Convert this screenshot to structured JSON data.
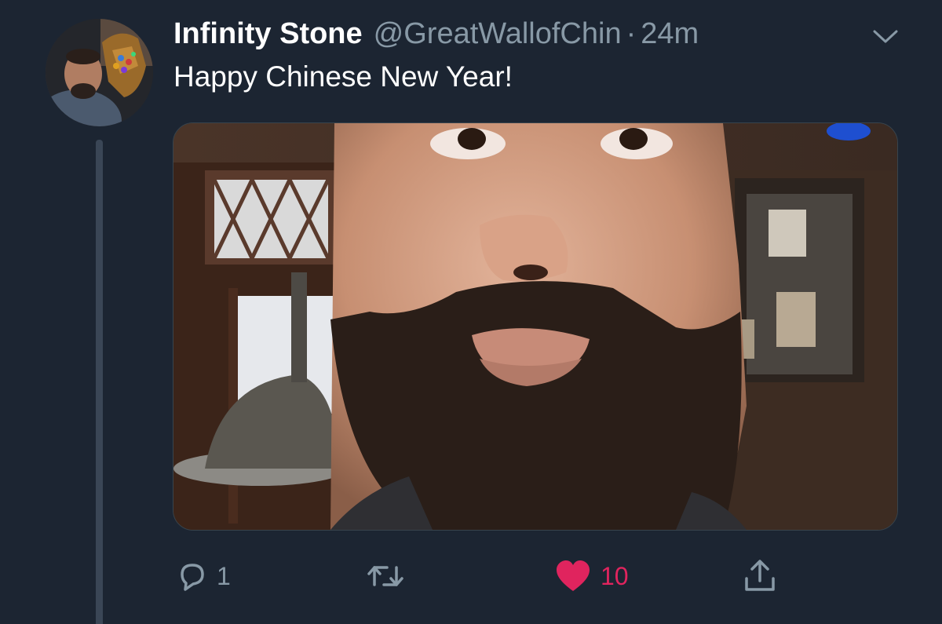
{
  "tweet": {
    "display_name": "Infinity Stone",
    "handle": "@GreatWallofChin",
    "separator": "·",
    "timestamp": "24m",
    "text": "Happy Chinese New Year!"
  },
  "actions": {
    "reply": {
      "icon": "reply-icon",
      "count": "1"
    },
    "retweet": {
      "icon": "retweet-icon",
      "count": ""
    },
    "like": {
      "icon": "heart-icon",
      "count": "10",
      "liked": true
    },
    "share": {
      "icon": "share-icon"
    }
  },
  "menu": {
    "icon": "chevron-down-icon"
  },
  "colors": {
    "background": "#1c2532",
    "primary_text": "#ffffff",
    "secondary_text": "#8899a6",
    "like_active": "#e0245e",
    "thread_line": "#3a4656"
  }
}
